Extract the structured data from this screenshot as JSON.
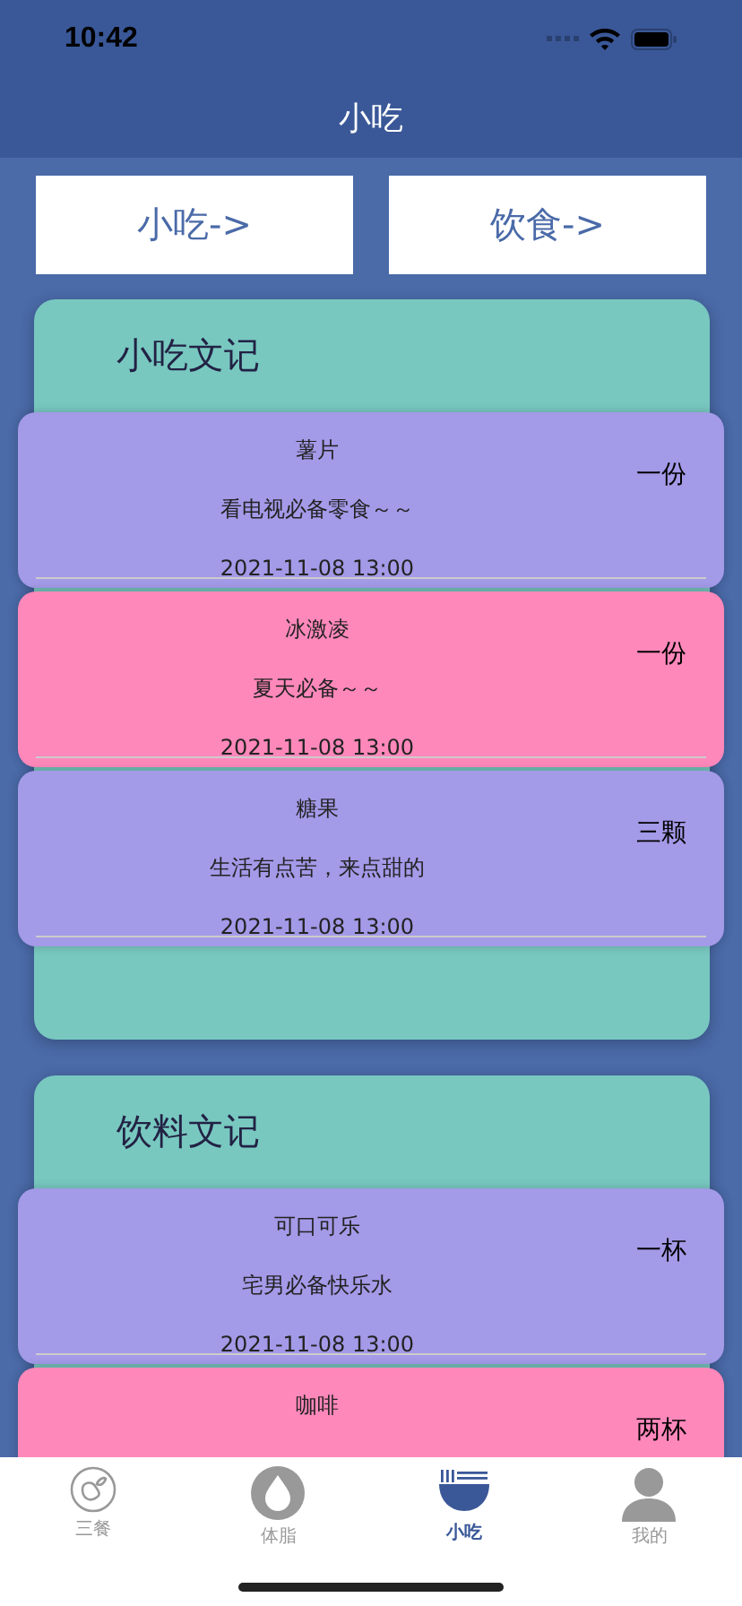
{
  "status_bar": {
    "time": "10:42"
  },
  "nav_bar": {
    "title": "小吃"
  },
  "buttons": [
    "小吃->",
    "饮食->"
  ],
  "sections": [
    {
      "title": "小吃文记",
      "items": [
        {
          "name": "薯片",
          "description": "看电视必备零食～～",
          "date": "2021-11-08 13:00",
          "quantity": "一份",
          "color": "#a39ae8"
        },
        {
          "name": "冰激凌",
          "description": "夏天必备～～",
          "date": "2021-11-08 13:00",
          "quantity": "一份",
          "color": "#ff88bb"
        },
        {
          "name": "糖果",
          "description": "生活有点苦，来点甜的",
          "date": "2021-11-08 13:00",
          "quantity": "三颗",
          "color": "#a39ae8"
        }
      ]
    },
    {
      "title": "饮料文记",
      "items": [
        {
          "name": "可口可乐",
          "description": "宅男必备快乐水",
          "date": "2021-11-08 13:00",
          "quantity": "一杯",
          "color": "#a39ae8"
        },
        {
          "name": "咖啡",
          "quantity": "两杯",
          "color": "#ff88bb"
        }
      ]
    }
  ],
  "tab_bar": [
    {
      "label": "三餐",
      "kind": "meal",
      "selected": false
    },
    {
      "label": "体脂",
      "kind": "drop",
      "selected": false
    },
    {
      "label": "小吃",
      "kind": "bowl",
      "selected": true
    },
    {
      "label": "我的",
      "kind": "person",
      "selected": false
    }
  ]
}
